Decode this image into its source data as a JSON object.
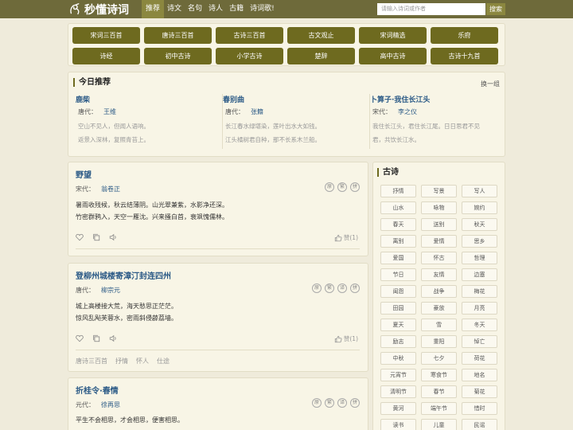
{
  "header": {
    "site_name": "秒懂诗词",
    "nav": [
      "推荐",
      "诗文",
      "名句",
      "诗人",
      "古籍",
      "诗词歌!"
    ],
    "search_placeholder": "请输入诗词或作者",
    "search_button": "搜索"
  },
  "categories": [
    "宋词三百首",
    "唐诗三百首",
    "古诗三百首",
    "古文观止",
    "宋词精选",
    "乐府",
    "诗经",
    "初中古诗",
    "小学古诗",
    "楚辞",
    "高中古诗",
    "古诗十九首"
  ],
  "recommend": {
    "title": "今日推荐",
    "switch": "换一组",
    "items": [
      {
        "name": "鹿柴",
        "dynasty": "唐代：",
        "author": "王维",
        "lines": [
          "空山不见人，但闻人语响。",
          "返景入深林，复照青苔上。"
        ]
      },
      {
        "name": "春别曲",
        "dynasty": "唐代：",
        "author": "张籍",
        "lines": [
          "长江春水绿堪染，莲叶出水大如钱。",
          "江头橘树君自种，那不长系木兰船。"
        ]
      },
      {
        "name": "卜算子·我住长江头",
        "dynasty": "宋代：",
        "author": "李之仪",
        "lines": [
          "我住长江头，君住长江尾。日日思君不见",
          "君，共饮长江水。"
        ]
      }
    ]
  },
  "poems": [
    {
      "title": "野望",
      "dynasty": "宋代：",
      "author": "翁卷正",
      "badges": [
        "原",
        "繁",
        "拼"
      ],
      "lines": [
        "暑雨收残候，秋云结薄阴。山光翠兼紫，水影净还深。",
        "竹密群鸦入，天空一雁沈。兴来搔白首，衰飒愧儒林。"
      ],
      "like": "赞(1)",
      "tags": []
    },
    {
      "title": "登柳州城楼寄漳汀封连四州",
      "dynasty": "唐代：",
      "author": "柳宗元",
      "badges": [
        "原",
        "繁",
        "译",
        "拼"
      ],
      "lines": [
        "城上高楼接大荒，海天愁思正茫茫。",
        "惊风乱飐芙蓉水，密雨斜侵薜荔墙。"
      ],
      "like": "赞(1)",
      "tags": [
        "唐诗三百首",
        "抒情",
        "怀人",
        "仕途"
      ]
    },
    {
      "title": "折桂令·春情",
      "dynasty": "元代：",
      "author": "徐再思",
      "badges": [
        "原",
        "繁",
        "译",
        "拼"
      ],
      "lines": [
        "平生不会相思，才会相思，便害相思。"
      ],
      "like": "",
      "tags": []
    }
  ],
  "sidebar": {
    "title": "古诗",
    "tags": [
      "抒情",
      "写景",
      "写人",
      "山水",
      "咏物",
      "婉约",
      "春天",
      "送别",
      "秋天",
      "离别",
      "爱情",
      "思乡",
      "爱国",
      "怀古",
      "哲理",
      "节日",
      "友情",
      "边塞",
      "闺怨",
      "战争",
      "梅花",
      "田园",
      "豪放",
      "月亮",
      "夏天",
      "雪",
      "冬天",
      "励志",
      "重阳",
      "悼亡",
      "中秋",
      "七夕",
      "荷花",
      "元宵节",
      "寒食节",
      "地名",
      "清明节",
      "春节",
      "菊花",
      "黄河",
      "端午节",
      "惜时",
      "读书",
      "儿童",
      "民谣"
    ]
  },
  "colors": {
    "topbar": "#6e6a3a",
    "accent": "#6e6a1f",
    "link": "#2b5a86",
    "bg": "#efebdb"
  }
}
